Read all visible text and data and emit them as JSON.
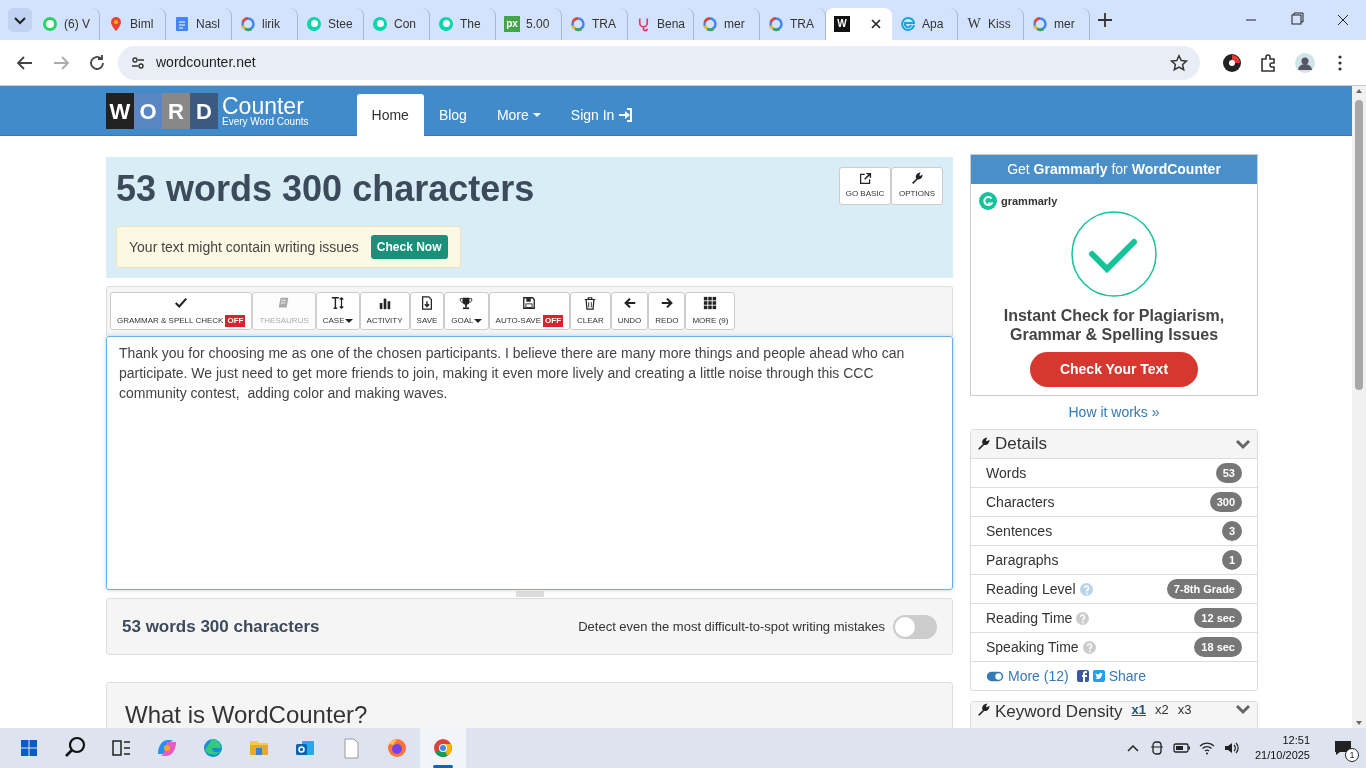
{
  "browser": {
    "tabs": [
      {
        "title": "(6) V",
        "kind": "chat",
        "selected": false
      },
      {
        "title": "Biml",
        "kind": "pin",
        "selected": false
      },
      {
        "title": "Nasl",
        "kind": "doc",
        "selected": false
      },
      {
        "title": "lirik",
        "kind": "google",
        "selected": false
      },
      {
        "title": "Stee",
        "kind": "swirl",
        "selected": false
      },
      {
        "title": "Con",
        "kind": "swirl",
        "selected": false
      },
      {
        "title": "The",
        "kind": "swirl",
        "selected": false
      },
      {
        "title": "5.00",
        "kind": "textbadge",
        "icon_text": "px",
        "selected": false
      },
      {
        "title": "TRA",
        "kind": "google",
        "selected": false
      },
      {
        "title": "Bena",
        "kind": "steth",
        "selected": false
      },
      {
        "title": "mer",
        "kind": "google",
        "selected": false
      },
      {
        "title": "TRA",
        "kind": "google",
        "selected": false
      },
      {
        "kind": "darkbadge",
        "icon_text": "W",
        "selected": true
      },
      {
        "title": "Apa",
        "kind": "edge",
        "selected": false
      },
      {
        "title": "Kiss",
        "kind": "wiki",
        "icon_text": "W",
        "selected": false
      },
      {
        "title": "mer",
        "kind": "google",
        "selected": false
      }
    ],
    "address": "wordcounter.net"
  },
  "site": {
    "logo_letters": [
      "W",
      "O",
      "R",
      "D"
    ],
    "logo_word": "Counter",
    "logo_tagline": "Every Word Counts",
    "nav": [
      {
        "label": "Home",
        "kind": "plain",
        "selected": true
      },
      {
        "label": "Blog",
        "kind": "plain",
        "selected": false
      },
      {
        "label": "More",
        "kind": "dropdown",
        "selected": false
      },
      {
        "label": "Sign In",
        "kind": "signin",
        "selected": false
      }
    ]
  },
  "counter": {
    "heading": "53 words 300 characters",
    "buttons": [
      {
        "label": "GO BASIC",
        "kind": "external"
      },
      {
        "label": "OPTIONS",
        "kind": "wrench"
      }
    ],
    "alert": {
      "text": "Your text might contain writing issues",
      "button": "Check Now"
    }
  },
  "toolbar": [
    {
      "label": "GRAMMAR & SPELL CHECK",
      "kind": "check",
      "badge": "OFF",
      "caret": false,
      "disabled": false
    },
    {
      "label": "THESAURUS",
      "kind": "book",
      "caret": false,
      "disabled": true
    },
    {
      "label": "CASE",
      "kind": "textcase",
      "caret": true,
      "disabled": false
    },
    {
      "label": "ACTIVITY",
      "kind": "bars",
      "caret": false,
      "disabled": false
    },
    {
      "label": "SAVE",
      "kind": "savedoc",
      "caret": false,
      "disabled": false
    },
    {
      "label": "GOAL",
      "kind": "trophy",
      "caret": true,
      "disabled": false
    },
    {
      "label": "AUTO-SAVE",
      "kind": "floppy",
      "badge": "OFF",
      "caret": false,
      "disabled": false
    },
    {
      "label": "CLEAR",
      "kind": "trash",
      "caret": false,
      "disabled": false
    },
    {
      "label": "UNDO",
      "kind": "left",
      "caret": false,
      "disabled": false
    },
    {
      "label": "REDO",
      "kind": "right",
      "caret": false,
      "disabled": false
    },
    {
      "label": "MORE (9)",
      "kind": "grid",
      "caret": false,
      "disabled": false
    }
  ],
  "editor": {
    "text": "Thank you for choosing me as one of the chosen participants. I believe there are many more things and people ahead who can participate. We just need to get more friends to join, making it even more lively and creating a little noise through this CCC community contest,  adding color and making waves."
  },
  "footer": {
    "summary": "53 words 300 characters",
    "toggle_label": "Detect even the most difficult-to-spot writing mistakes",
    "toggle_on": false
  },
  "section": {
    "heading": "What is WordCounter?"
  },
  "ad": {
    "header": "Get **Grammarly** for **WordCounter**",
    "brand": "grammarly",
    "headline": "Instant Check for Plagiarism, Grammar & Spelling Issues",
    "button": "Check Your Text"
  },
  "how_link": "How it works »",
  "details": {
    "title": "Details",
    "rows": [
      {
        "label": "Words",
        "value": "53",
        "help": false
      },
      {
        "label": "Characters",
        "value": "300",
        "help": false
      },
      {
        "label": "Sentences",
        "value": "3",
        "help": false
      },
      {
        "label": "Paragraphs",
        "value": "1",
        "help": false
      },
      {
        "label": "Reading Level",
        "value": "7-8th Grade",
        "help": true
      },
      {
        "label": "Reading Time",
        "value": "12 sec",
        "help": true
      },
      {
        "label": "Speaking Time",
        "value": "18 sec",
        "help": true
      }
    ],
    "more": "More (12)",
    "share": "Share"
  },
  "keyword_density": {
    "title": "Keyword Density",
    "options": [
      {
        "label": "x1",
        "selected": true
      },
      {
        "label": "x2",
        "selected": false
      },
      {
        "label": "x3",
        "selected": false
      }
    ]
  },
  "taskbar": {
    "apps": [
      {
        "kind": "copilot",
        "selected": false
      },
      {
        "kind": "edge",
        "selected": false
      },
      {
        "kind": "folder",
        "selected": false
      },
      {
        "kind": "outlook",
        "selected": false
      },
      {
        "kind": "file",
        "selected": false
      },
      {
        "kind": "firefox",
        "selected": false
      },
      {
        "kind": "chrome",
        "selected": true
      }
    ],
    "time": "12:51",
    "date": "21/10/2025",
    "notifications": "1"
  }
}
